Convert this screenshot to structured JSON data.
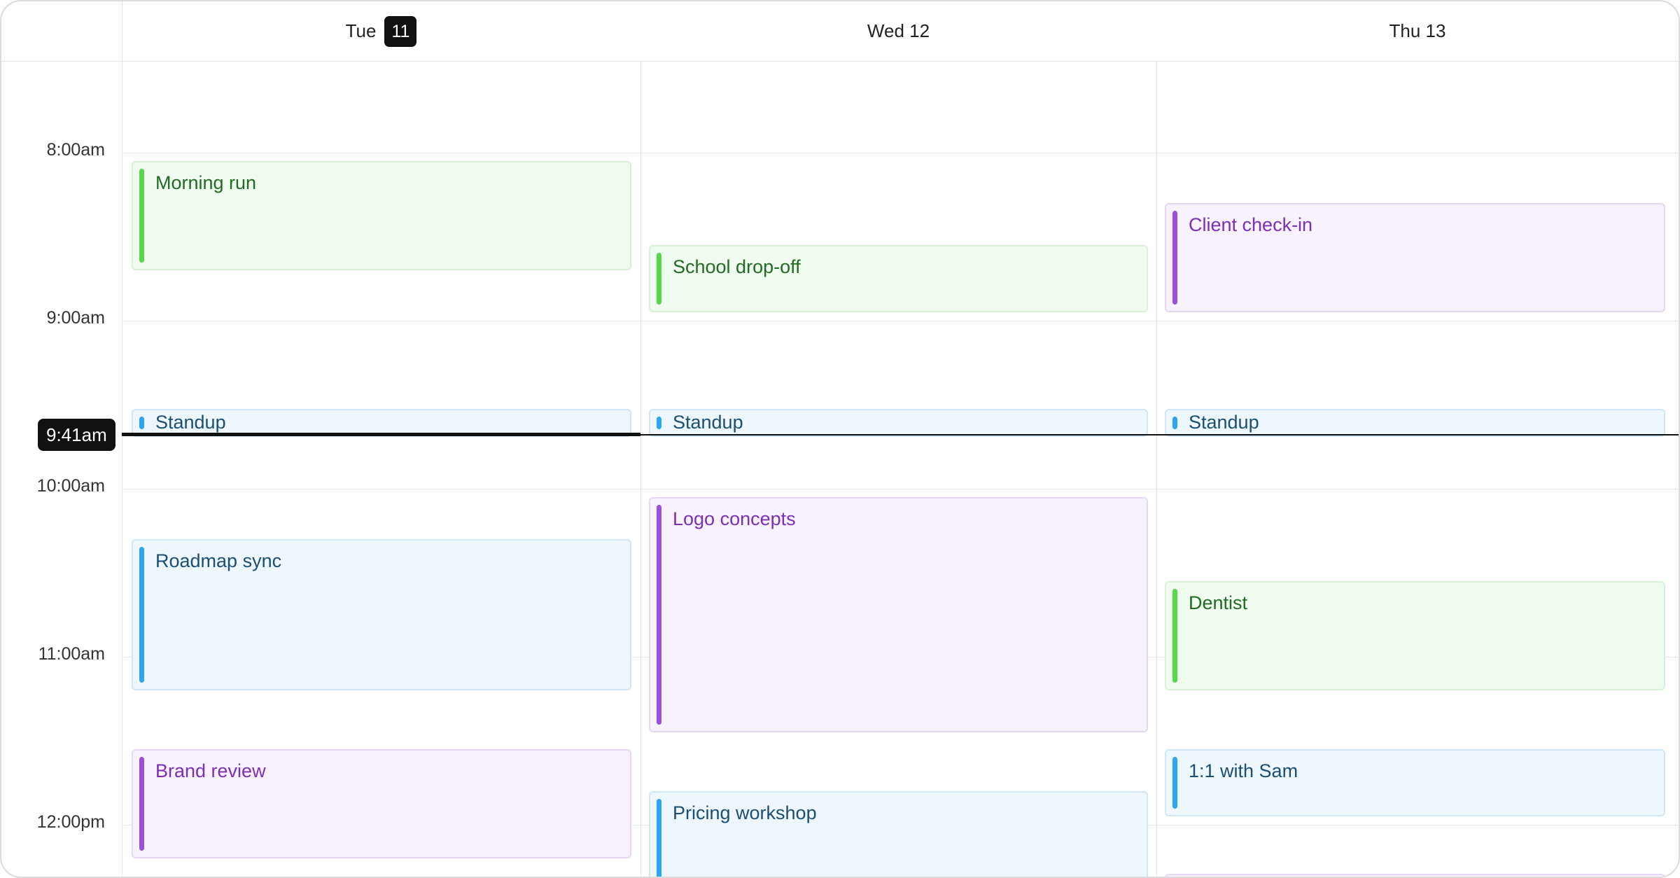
{
  "columns": [
    {
      "dow": "Tue",
      "date": "11",
      "is_today": true
    },
    {
      "label": "Wed 12"
    },
    {
      "label": "Thu 13"
    }
  ],
  "time_labels": [
    "8:00am",
    "9:00am",
    "10:00am",
    "11:00am",
    "12:00pm"
  ],
  "now": {
    "label": "9:41am"
  },
  "events": [
    {
      "title": "Morning run",
      "color": "green"
    },
    {
      "title": "Standup",
      "color": "blue"
    },
    {
      "title": "Roadmap sync",
      "color": "blue"
    },
    {
      "title": "Brand review",
      "color": "purple"
    },
    {
      "title": "School drop-off",
      "color": "green"
    },
    {
      "title": "Standup",
      "color": "blue"
    },
    {
      "title": "Logo concepts",
      "color": "purple"
    },
    {
      "title": "Pricing workshop",
      "color": "blue"
    },
    {
      "title": "Client check-in",
      "color": "purple"
    },
    {
      "title": "Standup",
      "color": "blue"
    },
    {
      "title": "Dentist",
      "color": "green"
    },
    {
      "title": "1:1 with Sam",
      "color": "blue"
    }
  ],
  "colors": {
    "green": "#55d84a",
    "blue": "#2aa6f2",
    "purple": "#9a4fdc",
    "now": "#111111"
  }
}
